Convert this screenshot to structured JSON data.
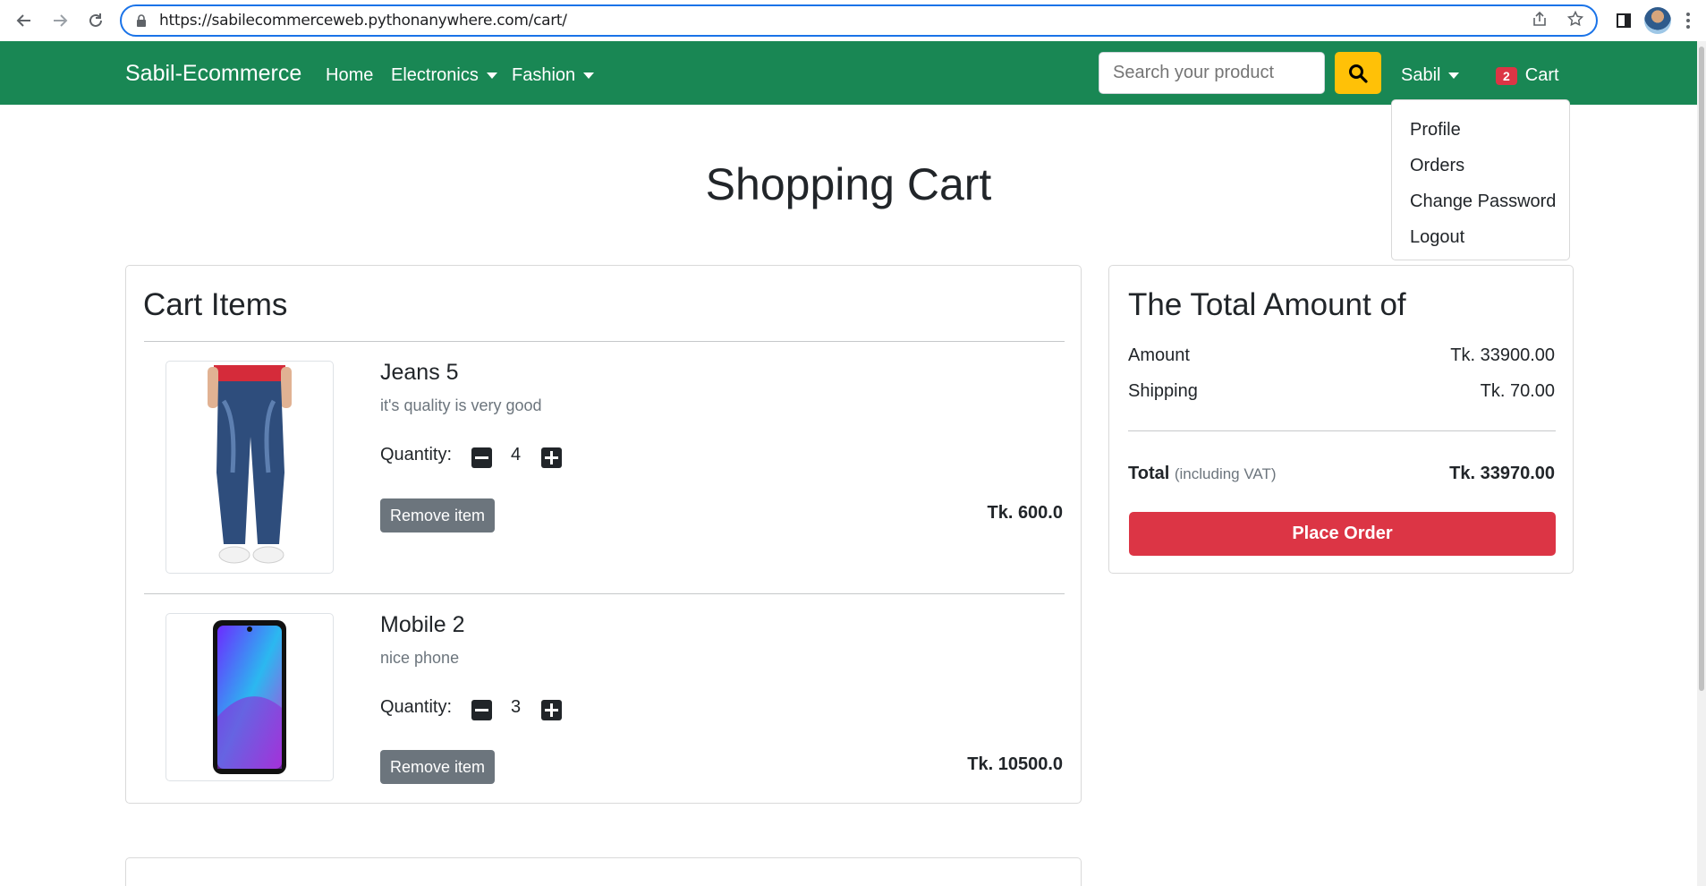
{
  "browser": {
    "url": "https://sabilecommerceweb.pythonanywhere.com/cart/"
  },
  "navbar": {
    "brand": "Sabil-Ecommerce",
    "links": [
      "Home",
      "Electronics",
      "Fashion"
    ],
    "search_placeholder": "Search your product",
    "user": "Sabil",
    "cart_count": "2",
    "cart_label": "Cart"
  },
  "user_menu": {
    "items": [
      "Profile",
      "Orders",
      "Change Password",
      "Logout"
    ]
  },
  "page": {
    "title": "Shopping Cart"
  },
  "cart": {
    "title": "Cart Items",
    "quantity_label": "Quantity:",
    "remove_label": "Remove item",
    "items": [
      {
        "name": "Jeans 5",
        "description": "it's quality is very good",
        "quantity": "4",
        "price": "Tk. 600.0"
      },
      {
        "name": "Mobile 2",
        "description": "nice phone",
        "quantity": "3",
        "price": "Tk. 10500.0"
      }
    ]
  },
  "summary": {
    "title": "The Total Amount of",
    "amount_label": "Amount",
    "amount_value": "Tk. 33900.00",
    "shipping_label": "Shipping",
    "shipping_value": "Tk. 70.00",
    "total_label": "Total",
    "total_note": "(including VAT)",
    "total_value": "Tk. 33970.00",
    "place_order": "Place Order"
  },
  "colors": {
    "navbar": "#198754",
    "search_button": "#ffc107",
    "danger": "#dc3545",
    "secondary": "#6c757d"
  }
}
